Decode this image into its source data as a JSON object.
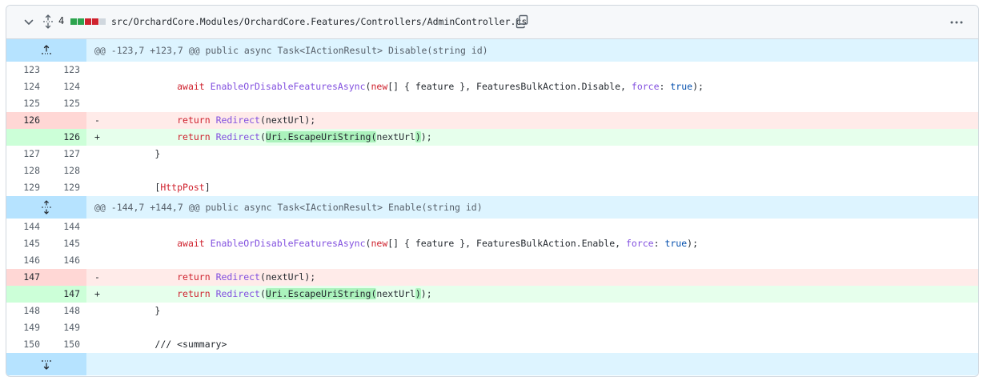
{
  "file": {
    "lines_changed": "4",
    "path": "src/OrchardCore.Modules/OrchardCore.Features/Controllers/AdminController.cs",
    "icons": {
      "collapse": "chevron-down-icon",
      "expand_all": "unfold-icon",
      "copy": "copy-icon",
      "kebab": "kebab-horizontal-icon"
    },
    "colors": {
      "added": "#2da44e",
      "deleted": "#cf222e",
      "neutral": "#d0d7de"
    }
  },
  "hunks": [
    {
      "header": "@@ -123,7 +123,7 @@ public async Task<IActionResult> Disable(string id)",
      "lines": [
        {
          "type": "ctx",
          "old": "123",
          "new": "123"
        },
        {
          "type": "ctx",
          "old": "124",
          "new": "124"
        },
        {
          "type": "ctx",
          "old": "125",
          "new": "125"
        },
        {
          "type": "del",
          "old": "126",
          "new": "",
          "marker": "-"
        },
        {
          "type": "add",
          "old": "",
          "new": "126",
          "marker": "+"
        },
        {
          "type": "ctx",
          "old": "127",
          "new": "127"
        },
        {
          "type": "ctx",
          "old": "128",
          "new": "128"
        },
        {
          "type": "ctx",
          "old": "129",
          "new": "129"
        }
      ],
      "code": {
        "await_kw": "await",
        "enable_fn": "EnableOrDisableFeaturesAsync",
        "open_paren": "(",
        "new_kw": "new",
        "array_body": "[] { feature }, FeaturesBulkAction.Disable, ",
        "force_param": "force",
        "colon": ": ",
        "true_lit": "true",
        "close": ");",
        "return_kw": "return",
        "redirect_fn": "Redirect",
        "next_url_del": "(nextUrl);",
        "paren_open": "(",
        "escape_call": "Uri.EscapeUriString(",
        "next_url": "nextUrl",
        "escape_close": ")",
        "end": ");",
        "brace": "}",
        "bracket_open": "[",
        "attribute": "HttpPost",
        "bracket_close": "]"
      }
    },
    {
      "header": "@@ -144,7 +144,7 @@ public async Task<IActionResult> Enable(string id)",
      "lines": [
        {
          "type": "ctx",
          "old": "144",
          "new": "144"
        },
        {
          "type": "ctx",
          "old": "145",
          "new": "145"
        },
        {
          "type": "ctx",
          "old": "146",
          "new": "146"
        },
        {
          "type": "del",
          "old": "147",
          "new": "",
          "marker": "-"
        },
        {
          "type": "add",
          "old": "",
          "new": "147",
          "marker": "+"
        },
        {
          "type": "ctx",
          "old": "148",
          "new": "148"
        },
        {
          "type": "ctx",
          "old": "149",
          "new": "149"
        },
        {
          "type": "ctx",
          "old": "150",
          "new": "150"
        }
      ],
      "code": {
        "await_kw": "await",
        "enable_fn": "EnableOrDisableFeaturesAsync",
        "open_paren": "(",
        "new_kw": "new",
        "array_body": "[] { feature }, FeaturesBulkAction.Enable, ",
        "force_param": "force",
        "colon": ": ",
        "true_lit": "true",
        "close": ");",
        "return_kw": "return",
        "redirect_fn": "Redirect",
        "next_url_del": "(nextUrl);",
        "paren_open": "(",
        "escape_call": "Uri.EscapeUriString(",
        "next_url": "nextUrl",
        "escape_close": ")",
        "end": ");",
        "brace": "}",
        "summary": "/// <summary>"
      }
    }
  ]
}
